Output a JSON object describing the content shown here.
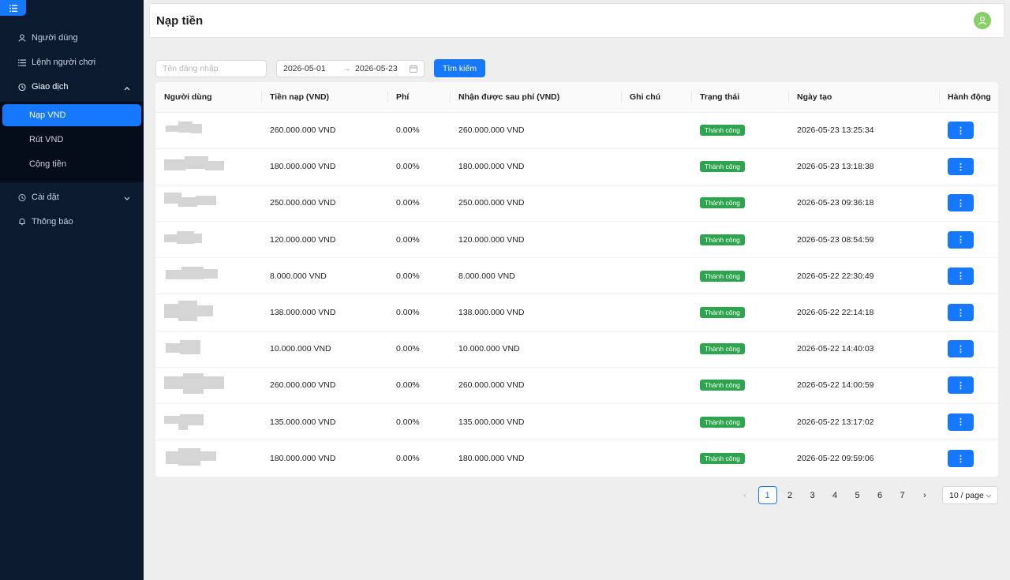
{
  "sidebar": {
    "items": [
      {
        "label": "Người dùng",
        "icon": "user-icon"
      },
      {
        "label": "Lệnh người chơi",
        "icon": "list-icon"
      },
      {
        "label": "Giao dịch",
        "icon": "transaction-icon"
      },
      {
        "label": "Cài đặt",
        "icon": "settings-icon"
      },
      {
        "label": "Thông báo",
        "icon": "bell-icon"
      }
    ],
    "submenu": [
      {
        "label": "Nạp VND"
      },
      {
        "label": "Rút VND"
      },
      {
        "label": "Cộng tiền"
      }
    ]
  },
  "header": {
    "title": "Nạp tiền"
  },
  "filters": {
    "username_placeholder": "Tên đăng nhập",
    "date_from": "2026-05-01",
    "date_to": "2026-05-23",
    "range_arrow": "→",
    "search_label": "Tìm kiếm"
  },
  "table": {
    "columns": [
      "Người dùng",
      "Tiền nạp (VND)",
      "Phí",
      "Nhận được sau phí (VND)",
      "Ghi chú",
      "Trạng thái",
      "Ngày tạo",
      "Hành động"
    ],
    "rows": [
      {
        "amount": "260.000.000 VND",
        "fee": "0.00%",
        "received": "260.000.000 VND",
        "note": "",
        "status": "Thành công",
        "created": "2026-05-23 13:25:34"
      },
      {
        "amount": "180.000.000 VND",
        "fee": "0.00%",
        "received": "180.000.000 VND",
        "note": "",
        "status": "Thành công",
        "created": "2026-05-23 13:18:38"
      },
      {
        "amount": "250.000.000 VND",
        "fee": "0.00%",
        "received": "250.000.000 VND",
        "note": "",
        "status": "Thành công",
        "created": "2026-05-23 09:36:18"
      },
      {
        "amount": "120.000.000 VND",
        "fee": "0.00%",
        "received": "120.000.000 VND",
        "note": "",
        "status": "Thành công",
        "created": "2026-05-23 08:54:59"
      },
      {
        "amount": "8.000.000 VND",
        "fee": "0.00%",
        "received": "8.000.000 VND",
        "note": "",
        "status": "Thành công",
        "created": "2026-05-22 22:30:49"
      },
      {
        "amount": "138.000.000 VND",
        "fee": "0.00%",
        "received": "138.000.000 VND",
        "note": "",
        "status": "Thành công",
        "created": "2026-05-22 22:14:18"
      },
      {
        "amount": "10.000.000 VND",
        "fee": "0.00%",
        "received": "10.000.000 VND",
        "note": "",
        "status": "Thành công",
        "created": "2026-05-22 14:40:03"
      },
      {
        "amount": "260.000.000 VND",
        "fee": "0.00%",
        "received": "260.000.000 VND",
        "note": "",
        "status": "Thành công",
        "created": "2026-05-22 14:00:59"
      },
      {
        "amount": "135.000.000 VND",
        "fee": "0.00%",
        "received": "135.000.000 VND",
        "note": "",
        "status": "Thành công",
        "created": "2026-05-22 13:17:02"
      },
      {
        "amount": "180.000.000 VND",
        "fee": "0.00%",
        "received": "180.000.000 VND",
        "note": "",
        "status": "Thành công",
        "created": "2026-05-22 09:59:06"
      }
    ],
    "action_label": "⋮"
  },
  "pagination": {
    "prev": "‹",
    "next": "›",
    "pages": [
      "1",
      "2",
      "3",
      "4",
      "5",
      "6",
      "7"
    ],
    "current": "1",
    "page_size": "10 / page"
  },
  "colors": {
    "sidebar_bg": "#0b1a2e",
    "accent": "#1677ff",
    "success": "#2da44e",
    "avatar": "#87d068"
  }
}
